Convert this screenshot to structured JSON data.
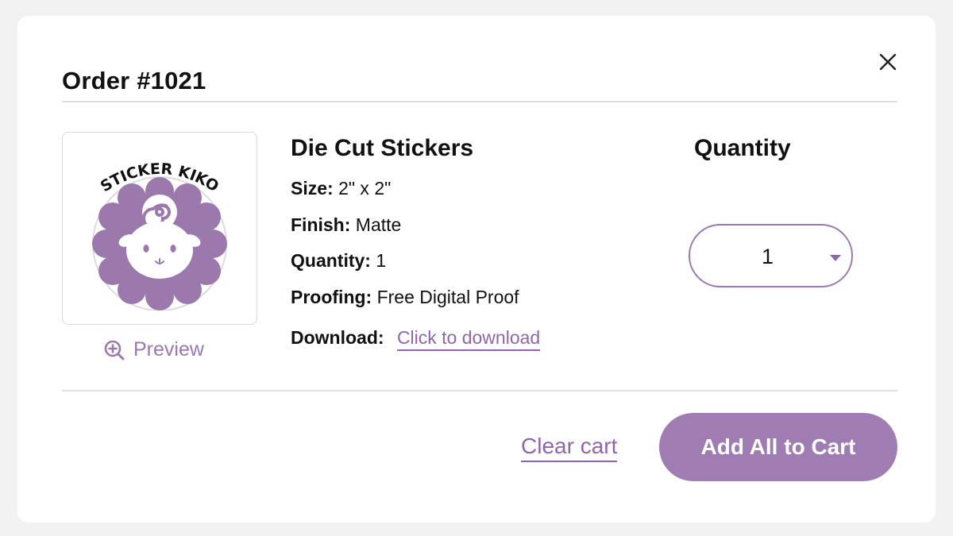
{
  "modal": {
    "title": "Order #1021",
    "close_icon": "close-icon"
  },
  "product": {
    "image": {
      "logo_text": "STICKER KIKO",
      "icon": "sheep-sticker-logo",
      "accent_color": "#9b79ad"
    },
    "preview_label": "Preview",
    "preview_icon": "zoom-in-icon",
    "name": "Die Cut Stickers",
    "specs": {
      "size_key": "Size:",
      "size_value": "2\" x 2\"",
      "finish_key": "Finish:",
      "finish_value": "Matte",
      "quantity_key": "Quantity:",
      "quantity_value": "1",
      "proofing_key": "Proofing:",
      "proofing_value": "Free Digital Proof",
      "download_key": "Download:",
      "download_link": "Click to download"
    }
  },
  "quantity": {
    "heading": "Quantity",
    "selected": "1",
    "caret_icon": "caret-down-icon"
  },
  "footer": {
    "clear_cart_label": "Clear cart",
    "add_all_label": "Add All to Cart"
  },
  "colors": {
    "brand": "#9f7db3",
    "link": "#8f66a8",
    "divider": "#e0e0e0"
  }
}
